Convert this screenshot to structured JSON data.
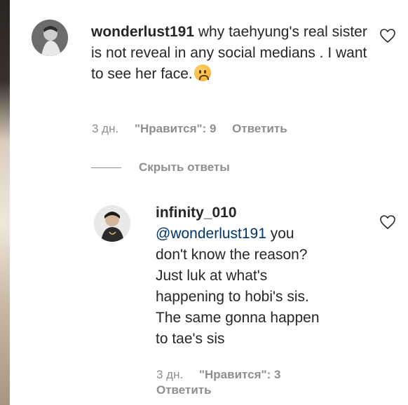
{
  "comment": {
    "username": "wonderlust191",
    "text": "why taehyung's real sister is not reveal in any social medians . I want to see her face.",
    "emoji": "worried-face",
    "time": "3 дн.",
    "likes": "\"Нравится\": 9",
    "reply_label": "Ответить"
  },
  "hide_replies_label": "Скрыть ответы",
  "reply": {
    "username": "infinity_010",
    "mention": "@wonderlust191",
    "text_line1": " you",
    "text_rest": [
      "don't know the reason?",
      "Just luk at what's",
      "happening to hobi's sis.",
      "The same gonna happen",
      "to tae's sis"
    ],
    "time": "3 дн.",
    "likes": "\"Нравится\": 3",
    "reply_label": "Ответить"
  }
}
